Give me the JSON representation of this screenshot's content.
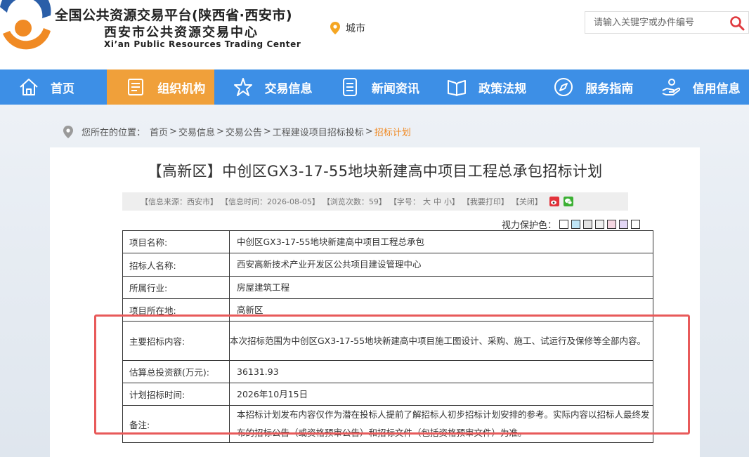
{
  "header": {
    "title": "全国公共资源交易平台(陕西省·西安市)",
    "subtitle": "西安市公共资源交易中心",
    "english": "Xi’an Public Resources Trading Center",
    "city_label": "城市",
    "search_placeholder": "请输入关键字或办件编号",
    "brand_colors": {
      "orange": "#f08a24",
      "blue": "#2a5ea8"
    }
  },
  "nav": {
    "items": [
      {
        "label": "首页",
        "icon": "home-icon"
      },
      {
        "label": "组织机构",
        "icon": "document-icon",
        "active": true
      },
      {
        "label": "交易信息",
        "icon": "star-icon"
      },
      {
        "label": "新闻资讯",
        "icon": "list-icon"
      },
      {
        "label": "政策法规",
        "icon": "book-icon"
      },
      {
        "label": "服务指南",
        "icon": "compass-icon"
      },
      {
        "label": "信用信息",
        "icon": "hand-icon"
      }
    ],
    "colors": {
      "bar": "#3d8fe6",
      "active": "#f0a03a"
    }
  },
  "breadcrumb": {
    "label": "您所在的位置：",
    "items": [
      "首页",
      "交易信息",
      "交易公告",
      "工程建设项目招标投标",
      "招标计划"
    ],
    "separator": ">"
  },
  "article": {
    "title": "【高新区】中创区GX3-17-55地块新建高中项目工程总承包招标计划",
    "meta": {
      "source": "【信息来源：西安市】",
      "time": "【信息时间：2026-08-05】",
      "views": "【浏览次数：59】",
      "font_label": "【字号：",
      "font_large": "大",
      "font_medium": "中",
      "font_small": "小】",
      "print": "【我要打印】",
      "close": "【关闭】"
    },
    "vision_label": "视力保护色：",
    "vision_swatches": [
      "#ffffff",
      "#bfe6f7",
      "#e3e3e3",
      "#f0f0f0",
      "#f5d7e2",
      "#e3d6f5",
      "#ffffff"
    ],
    "rows": [
      {
        "key": "项目名称:",
        "value": "中创区GX3-17-55地块新建高中项目工程总承包"
      },
      {
        "key": "招标人名称:",
        "value": "西安高新技术产业开发区公共项目建设管理中心"
      },
      {
        "key": "所属行业:",
        "value": "房屋建筑工程"
      },
      {
        "key": "项目所在地:",
        "value": "高新区"
      },
      {
        "key": "主要招标内容:",
        "value": "本次招标范围为中创区GX3-17-55地块新建高中项目施工图设计、采购、施工、试运行及保修等全部内容。"
      },
      {
        "key": "估算总投资额(万元):",
        "value": "36131.93"
      },
      {
        "key": "计划招标时间:",
        "value": "2026年10月15日"
      },
      {
        "key": "备注:",
        "value": "本招标计划发布内容仅作为潜在投标人提前了解招标人初步招标计划安排的参考。实际内容以招标人最终发布的招标公告（或资格预审公告）和招标文件（包括资格预审文件）为准。"
      }
    ],
    "highlight_color": "#e85a5a"
  }
}
